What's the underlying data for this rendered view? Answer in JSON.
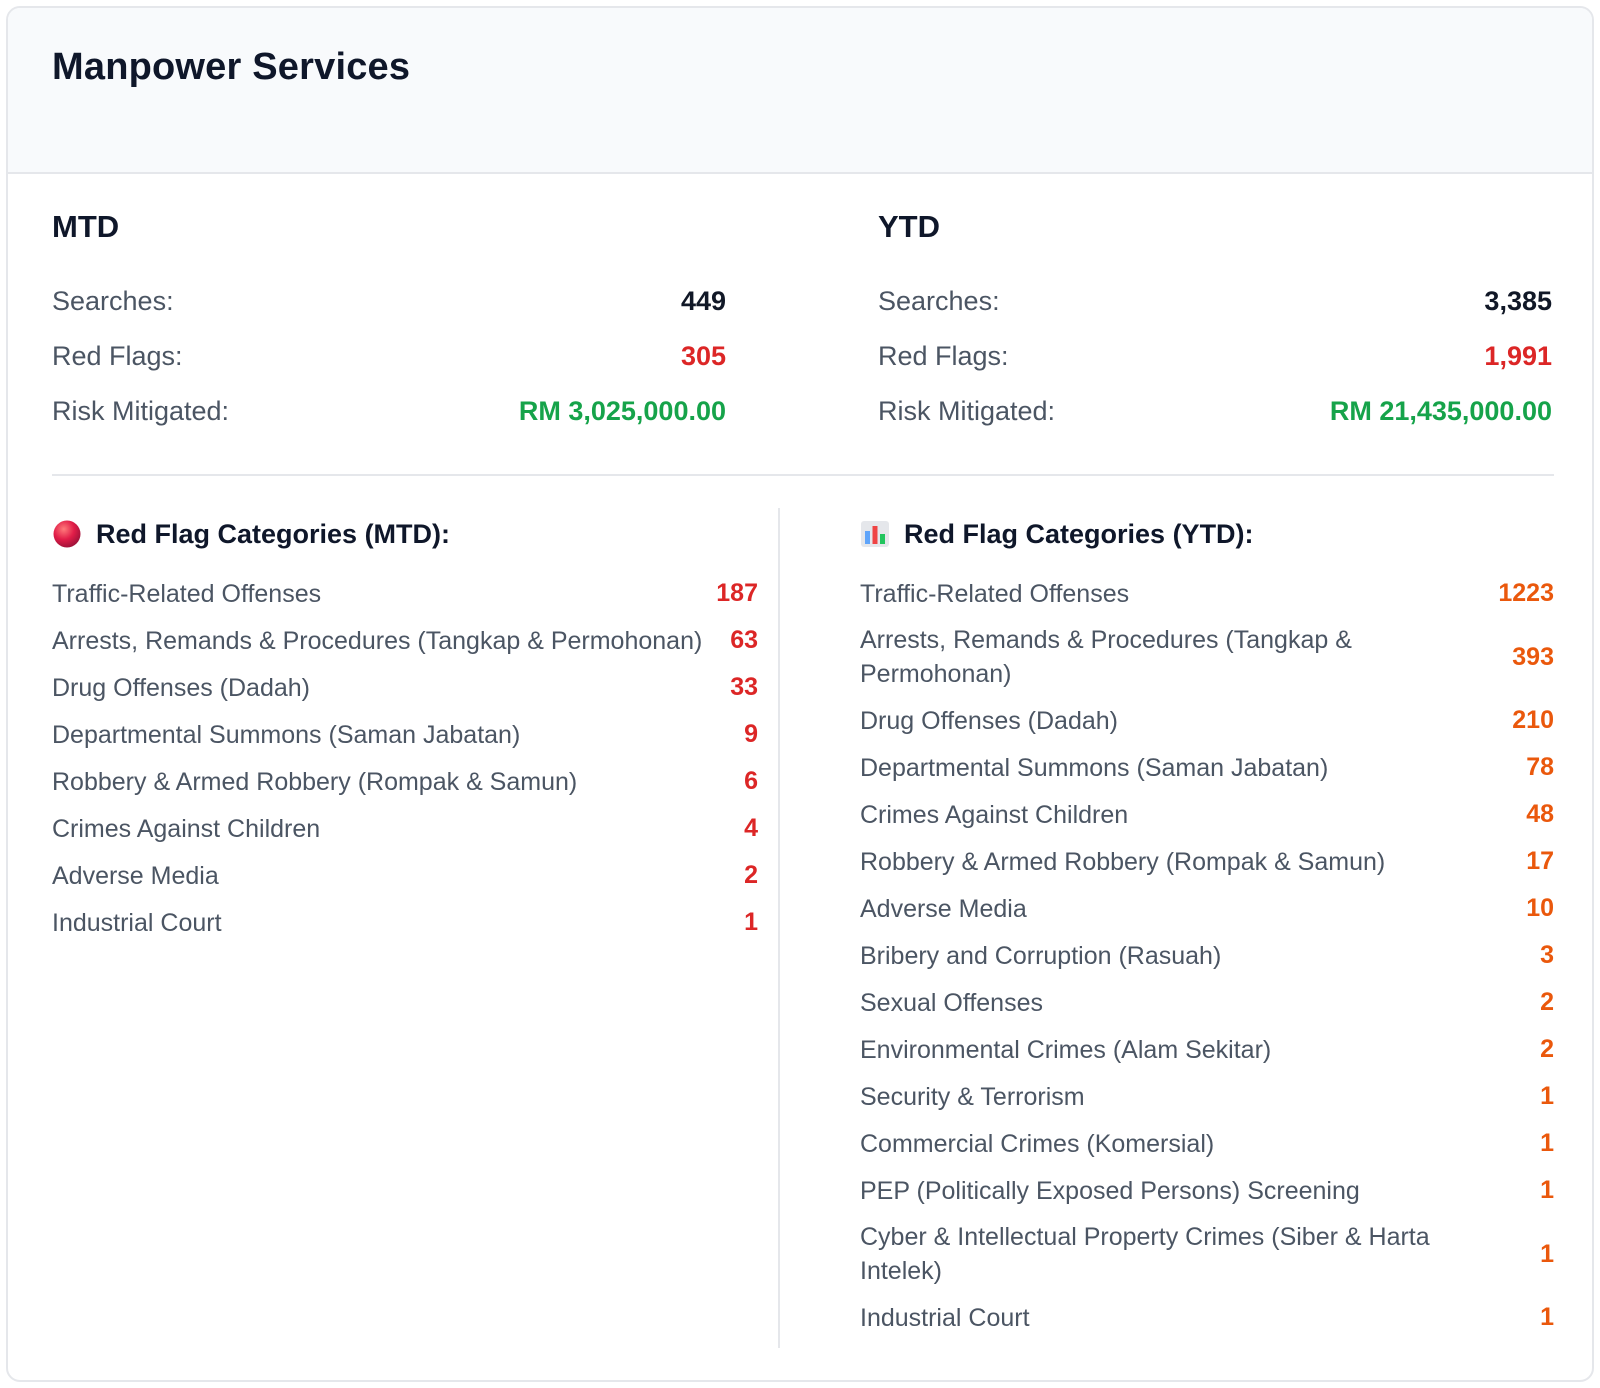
{
  "header": {
    "title": "Manpower Services"
  },
  "mtd": {
    "title": "MTD",
    "stats": [
      {
        "label": "Searches:",
        "value": "449"
      },
      {
        "label": "Red Flags:",
        "value": "305"
      },
      {
        "label": "Risk Mitigated:",
        "value": "RM 3,025,000.00"
      }
    ]
  },
  "ytd": {
    "title": "YTD",
    "stats": [
      {
        "label": "Searches:",
        "value": "3,385"
      },
      {
        "label": "Red Flags:",
        "value": "1,991"
      },
      {
        "label": "Risk Mitigated:",
        "value": "RM 21,435,000.00"
      }
    ]
  },
  "colors": {
    "red": "#dc2626",
    "green": "#16a34a",
    "orange": "#ea580c"
  },
  "mtd_categories": {
    "title": "Red Flag Categories (MTD):",
    "icon": "red-circle-icon",
    "items": [
      {
        "label": "Traffic-Related Offenses",
        "count": "187"
      },
      {
        "label": "Arrests, Remands & Procedures (Tangkap & Permohonan)",
        "count": "63"
      },
      {
        "label": "Drug Offenses (Dadah)",
        "count": "33"
      },
      {
        "label": "Departmental Summons (Saman Jabatan)",
        "count": "9"
      },
      {
        "label": "Robbery & Armed Robbery (Rompak & Samun)",
        "count": "6"
      },
      {
        "label": "Crimes Against Children",
        "count": "4"
      },
      {
        "label": "Adverse Media",
        "count": "2"
      },
      {
        "label": "Industrial Court",
        "count": "1"
      }
    ]
  },
  "ytd_categories": {
    "title": "Red Flag Categories (YTD):",
    "icon": "bar-chart-icon",
    "items": [
      {
        "label": "Traffic-Related Offenses",
        "count": "1223"
      },
      {
        "label": "Arrests, Remands & Procedures (Tangkap & Permohonan)",
        "count": "393"
      },
      {
        "label": "Drug Offenses (Dadah)",
        "count": "210"
      },
      {
        "label": "Departmental Summons (Saman Jabatan)",
        "count": "78"
      },
      {
        "label": "Crimes Against Children",
        "count": "48"
      },
      {
        "label": "Robbery & Armed Robbery (Rompak & Samun)",
        "count": "17"
      },
      {
        "label": "Adverse Media",
        "count": "10"
      },
      {
        "label": "Bribery and Corruption (Rasuah)",
        "count": "3"
      },
      {
        "label": "Sexual Offenses",
        "count": "2"
      },
      {
        "label": "Environmental Crimes (Alam Sekitar)",
        "count": "2"
      },
      {
        "label": "Security & Terrorism",
        "count": "1"
      },
      {
        "label": "Commercial Crimes (Komersial)",
        "count": "1"
      },
      {
        "label": "PEP (Politically Exposed Persons) Screening",
        "count": "1"
      },
      {
        "label": "Cyber & Intellectual Property Crimes (Siber & Harta Intelek)",
        "count": "1"
      },
      {
        "label": "Industrial Court",
        "count": "1"
      }
    ]
  }
}
